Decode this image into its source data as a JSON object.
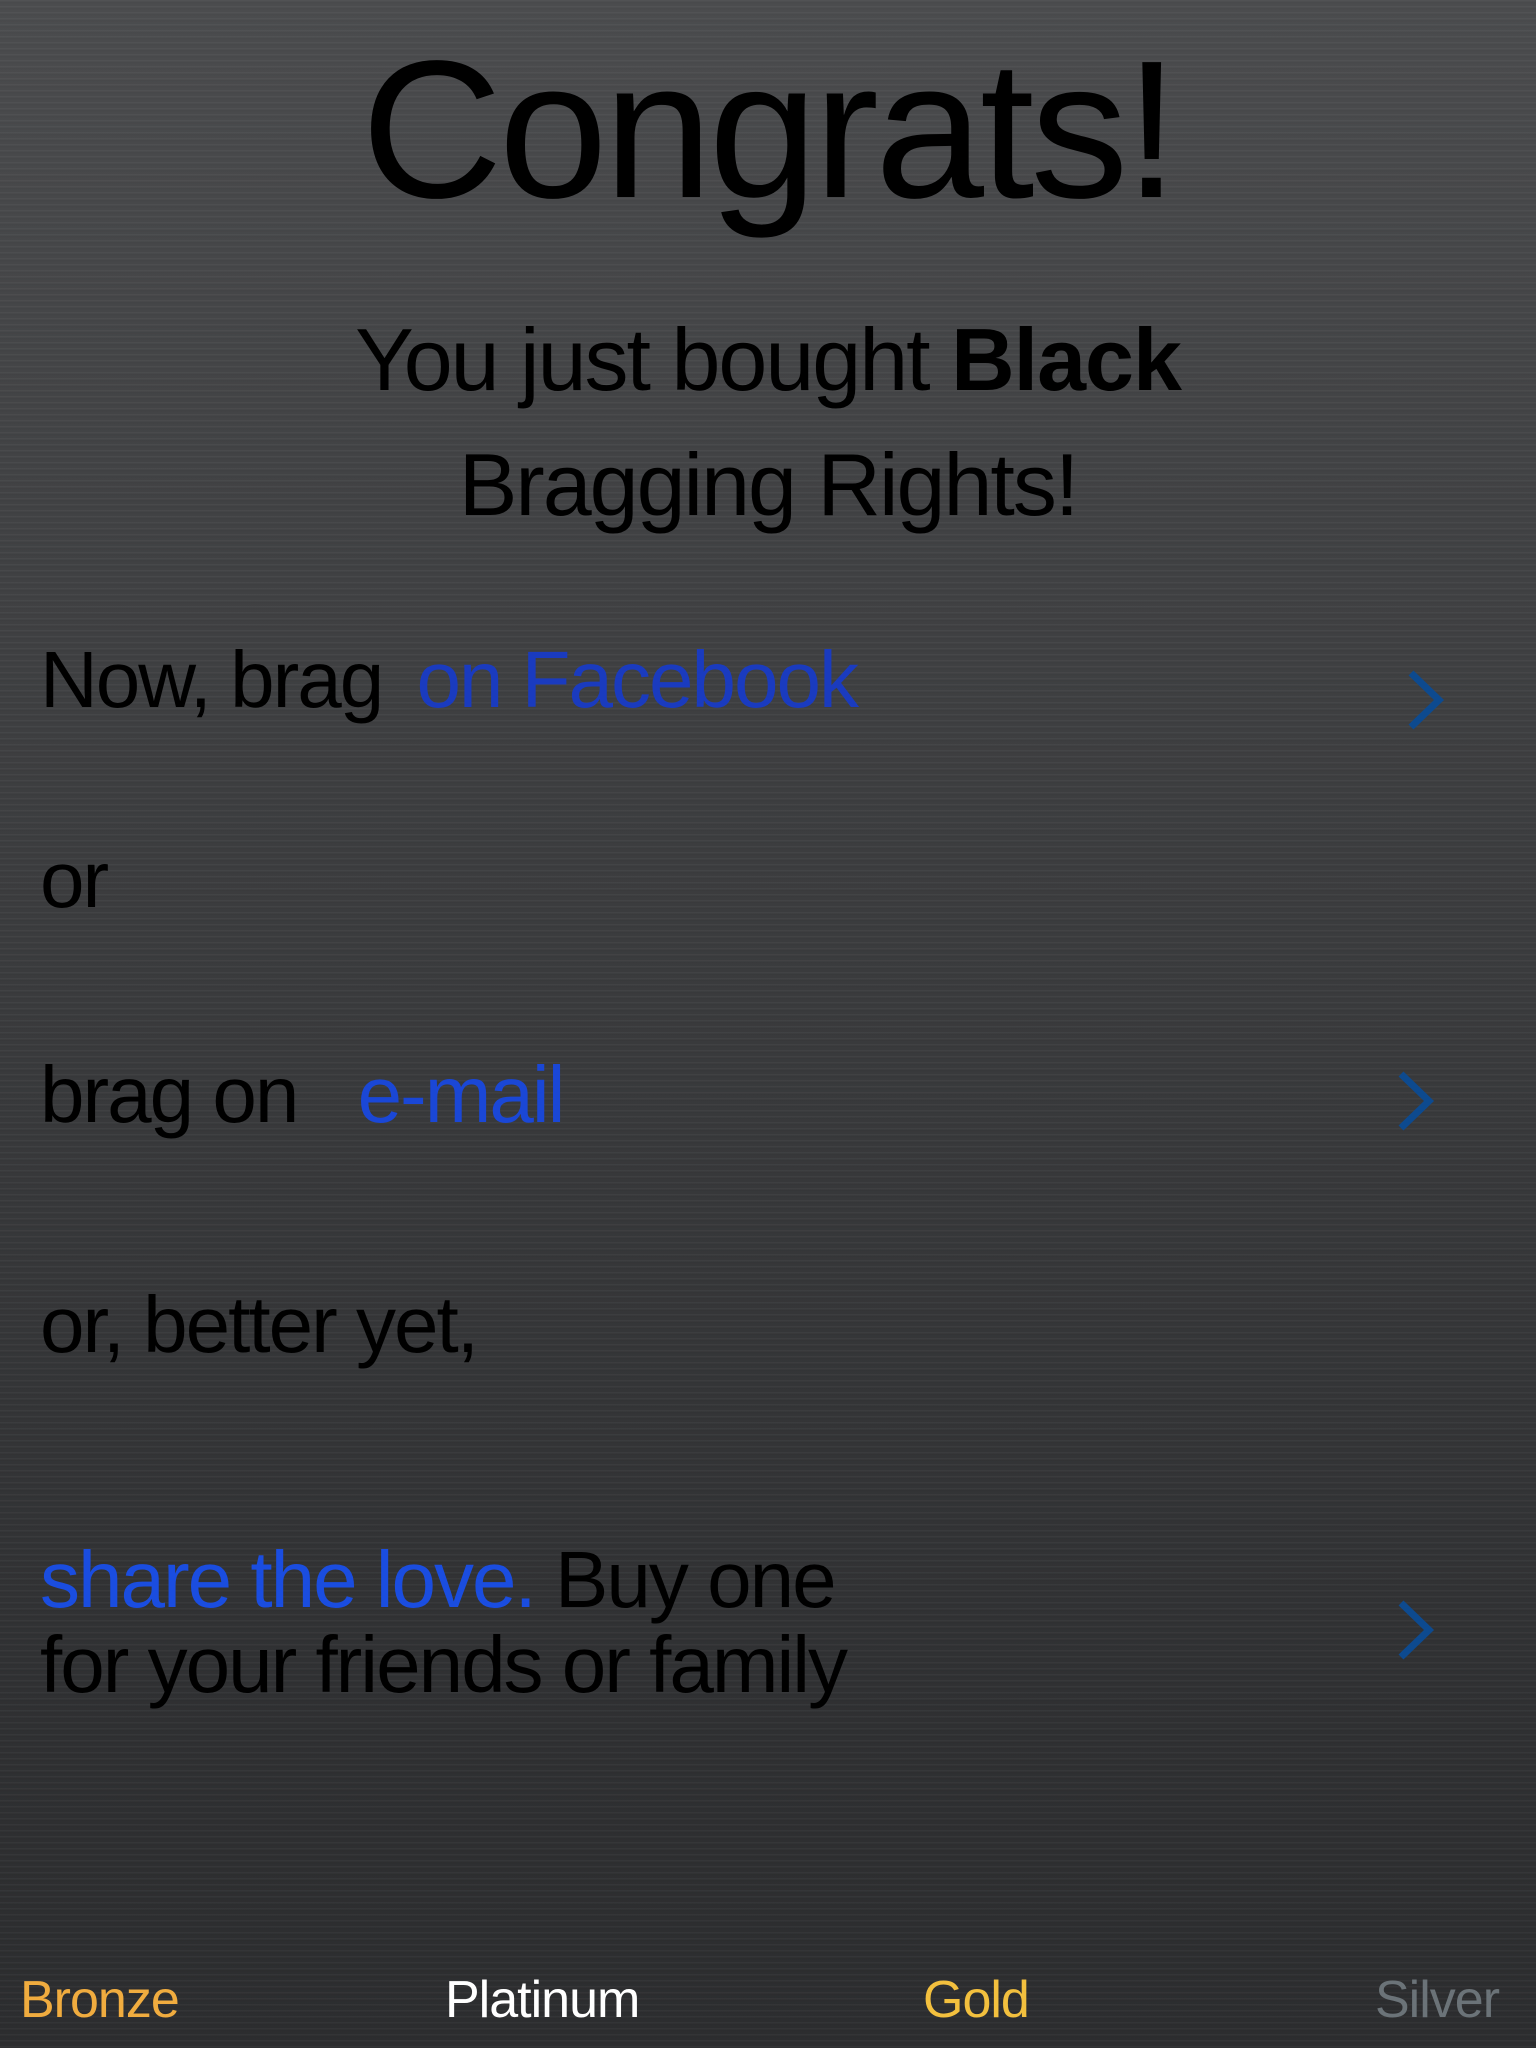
{
  "header": {
    "title": "Congrats!",
    "subtitle_prefix": "You just bought",
    "subtitle_bold": "Black",
    "subtitle_line2": "Bragging Rights!"
  },
  "options": {
    "facebook": {
      "prefix": "Now, brag",
      "link": "on Facebook",
      "chevron_icon": "chevron-right-icon"
    },
    "or1": "or",
    "email": {
      "prefix": "brag on",
      "link": "e-mail",
      "chevron_icon": "chevron-right-icon"
    },
    "or2": "or, better yet,",
    "share": {
      "link": "share the love.",
      "text1": "Buy one",
      "text2": "for your friends or family",
      "chevron_icon": "chevron-right-icon"
    }
  },
  "tabs": [
    {
      "label": "Bronze",
      "color": "#f0ac3f"
    },
    {
      "label": "Platinum",
      "color": "#ffffff"
    },
    {
      "label": "Gold",
      "color": "#f3c03e"
    },
    {
      "label": "Silver",
      "color": "#6b7378"
    }
  ],
  "colors": {
    "link": "#1a3bbf",
    "chevron": "#0d4a8f"
  }
}
